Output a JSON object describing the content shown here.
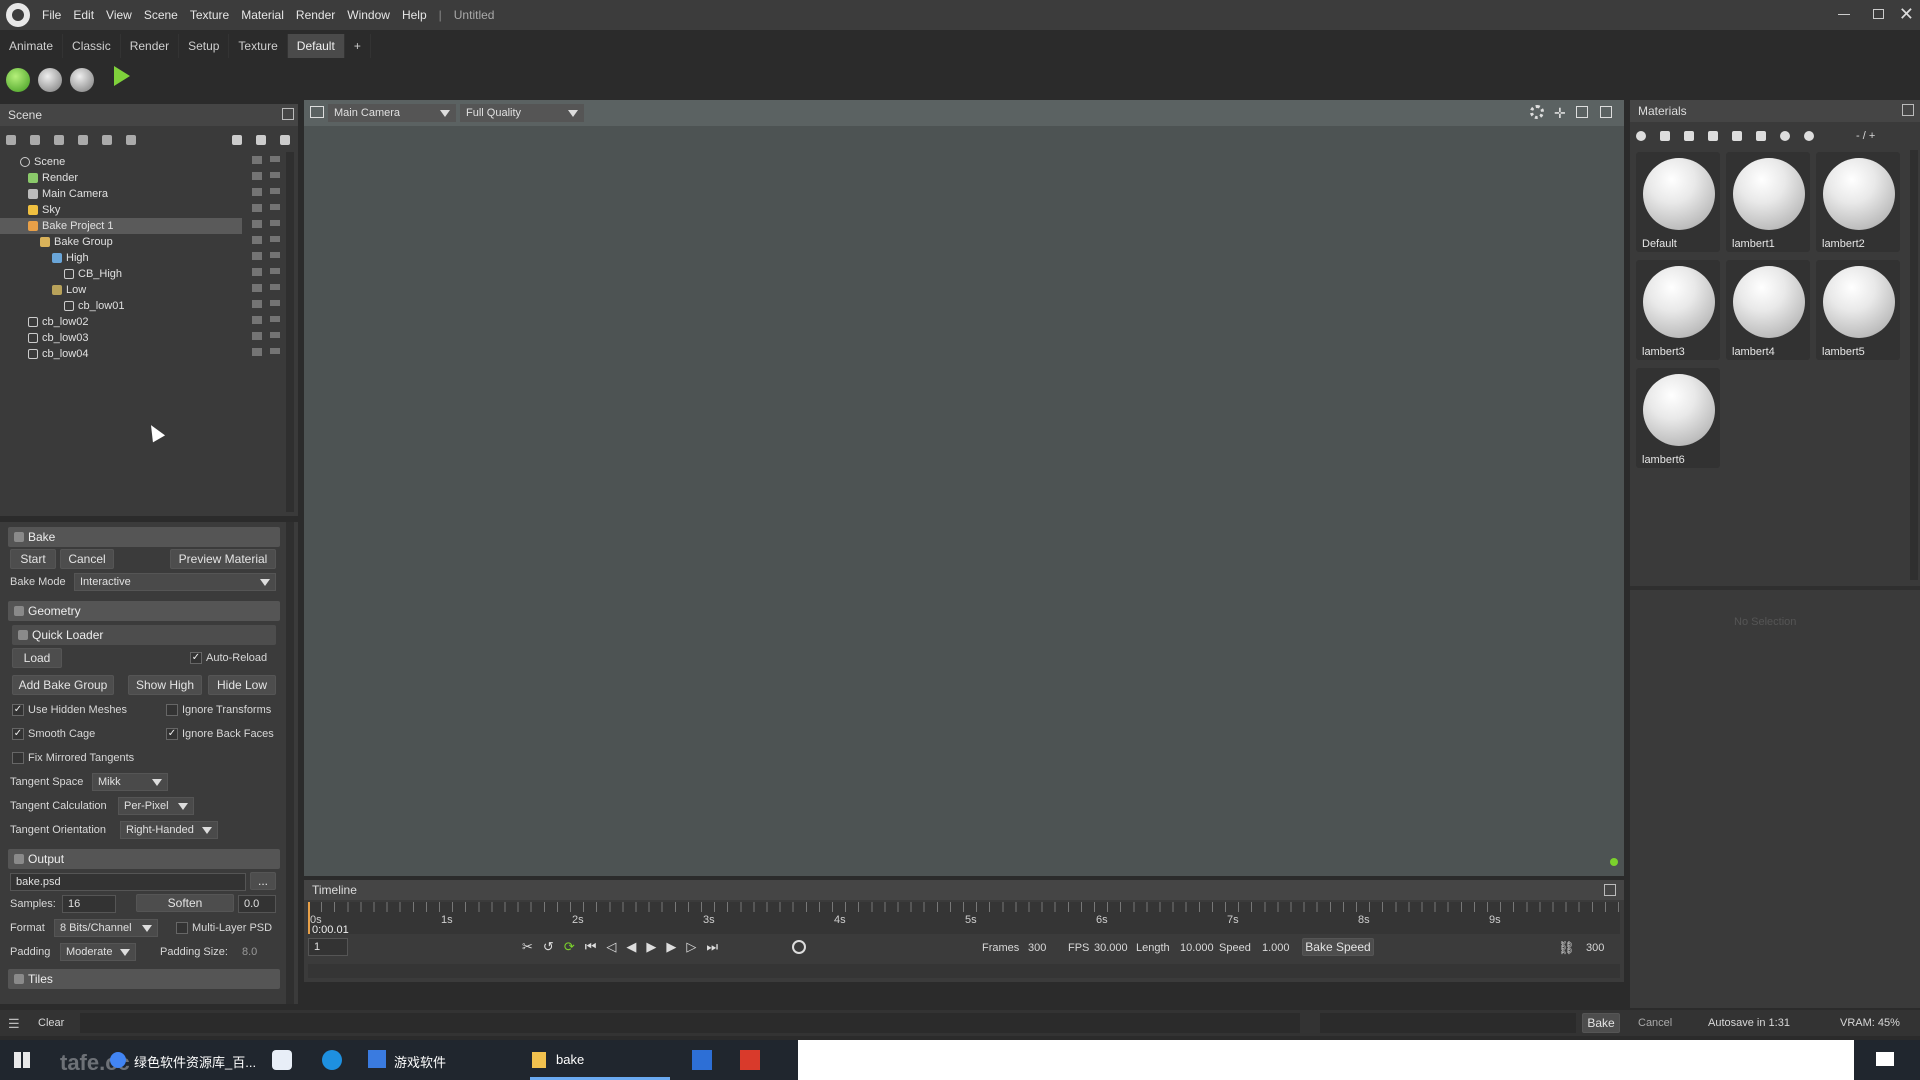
{
  "menubar": {
    "items": [
      "File",
      "Edit",
      "View",
      "Scene",
      "Texture",
      "Material",
      "Render",
      "Window",
      "Help",
      "|",
      "Untitled"
    ]
  },
  "tabs": [
    "Animate",
    "Classic",
    "Render",
    "Setup",
    "Texture",
    "Default",
    "+"
  ],
  "scene_panel": {
    "title": "Scene",
    "tree": [
      {
        "label": "Scene",
        "indent": 0
      },
      {
        "label": "Render",
        "indent": 1
      },
      {
        "label": "Main Camera",
        "indent": 1
      },
      {
        "label": "Sky",
        "indent": 1
      },
      {
        "label": "Bake Project 1",
        "indent": 1
      },
      {
        "label": "Bake Group",
        "indent": 2
      },
      {
        "label": "High",
        "indent": 3
      },
      {
        "label": "CB_High",
        "indent": 4
      },
      {
        "label": "Low",
        "indent": 3
      },
      {
        "label": "cb_low01",
        "indent": 4
      },
      {
        "label": "cb_low02",
        "indent": 1
      },
      {
        "label": "cb_low03",
        "indent": 1
      },
      {
        "label": "cb_low04",
        "indent": 1
      }
    ]
  },
  "bake": {
    "title": "Bake",
    "start": "Start",
    "cancel": "Cancel",
    "preview": "Preview Material",
    "mode_label": "Bake Mode",
    "mode_value": "Interactive",
    "geometry": "Geometry",
    "quick_loader": "Quick Loader",
    "load": "Load",
    "auto_reload": "Auto-Reload",
    "add_group": "Add Bake Group",
    "show_high": "Show High",
    "hide_low": "Hide Low",
    "use_hidden": "Use Hidden Meshes",
    "ignore_transforms": "Ignore Transforms",
    "smooth_cage": "Smooth Cage",
    "ignore_back": "Ignore Back Faces",
    "fix_mirrored": "Fix Mirrored Tangents",
    "tangent_space_label": "Tangent Space",
    "tangent_space_value": "Mikk",
    "tangent_calc_label": "Tangent Calculation",
    "tangent_calc_value": "Per-Pixel",
    "tangent_orient_label": "Tangent Orientation",
    "tangent_orient_value": "Right-Handed",
    "output": "Output",
    "file": "bake.psd",
    "browse": "...",
    "samples_label": "Samples:",
    "samples_value": "16",
    "soften_label": "Soften",
    "soften_value": "0.0",
    "format_label": "Format",
    "format_value": "8 Bits/Channel",
    "multilayer": "Multi-Layer PSD",
    "padding_label": "Padding",
    "padding_value": "Moderate",
    "padding_size_label": "Padding Size:",
    "padding_size_value": "8.0",
    "tiles": "Tiles"
  },
  "viewport": {
    "camera": "Main Camera",
    "quality": "Full Quality"
  },
  "materials": {
    "title": "Materials",
    "page": "- / +",
    "items": [
      "Default",
      "lambert1",
      "lambert2",
      "lambert3",
      "lambert4",
      "lambert5",
      "lambert6"
    ],
    "no_selection": "No Selection"
  },
  "timeline": {
    "title": "Timeline",
    "ticks": [
      "0s",
      "1s",
      "2s",
      "3s",
      "4s",
      "5s",
      "6s",
      "7s",
      "8s",
      "9s"
    ],
    "current_time": "0:00.01",
    "frame": "1",
    "frames_label": "Frames",
    "frames_value": "300",
    "fps_label": "FPS",
    "fps_value": "30.000",
    "length_label": "Length",
    "length_value": "10.000",
    "speed_label": "Speed",
    "speed_value": "1.000",
    "bake_speed": "Bake Speed",
    "end_frame": "300"
  },
  "statusbar": {
    "clear": "Clear",
    "bake": "Bake",
    "cancel": "Cancel",
    "autosave": "Autosave in 1:31",
    "vram": "VRAM: 45%"
  },
  "taskbar": {
    "app1": "绿色软件资源库_百...",
    "app2": "游戏软件",
    "app3": "bake",
    "watermark": "tafe.cc"
  }
}
